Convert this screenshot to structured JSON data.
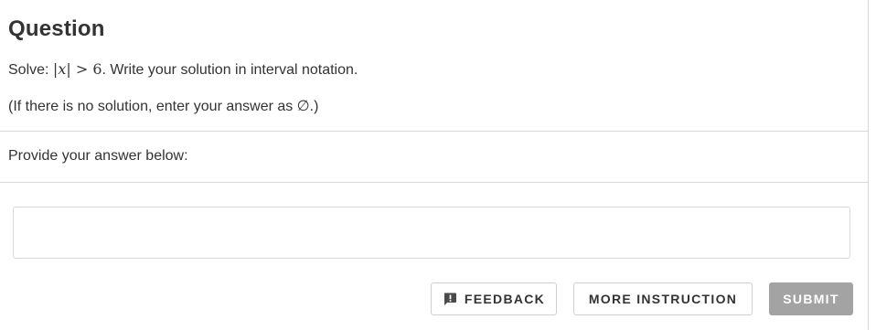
{
  "question": {
    "title": "Question",
    "line1": {
      "prefix": "Solve: ",
      "math_left": "|",
      "math_var": "x",
      "math_right": "| > 6",
      "suffix": ". Write your solution in interval notation."
    },
    "line2": "(If there is no solution, enter your answer as ∅.)"
  },
  "answer": {
    "prompt": "Provide your answer below:",
    "value": "",
    "placeholder": ""
  },
  "buttons": {
    "feedback_label": "FEEDBACK",
    "feedback_icon": "feedback-icon",
    "more_instruction_label": "MORE INSTRUCTION",
    "submit_label": "SUBMIT"
  },
  "colors": {
    "text": "#333333",
    "border": "#d9d9d9",
    "submit_disabled_bg": "#a3a3a3",
    "icon": "#4a4a4a"
  }
}
